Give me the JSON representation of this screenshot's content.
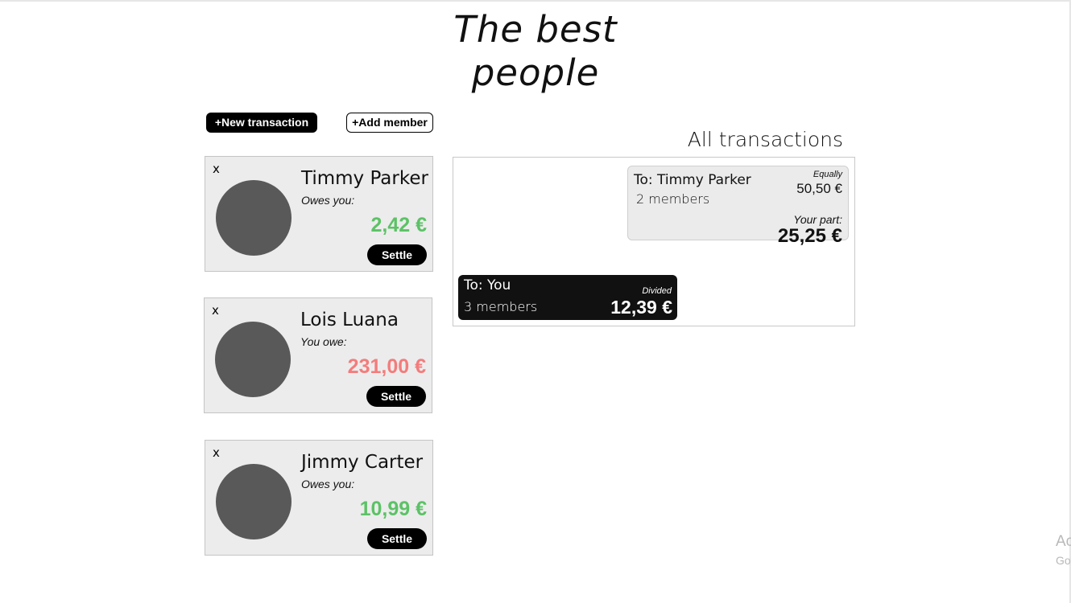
{
  "page": {
    "title": "The best people"
  },
  "actions": {
    "new_transaction_label": "+New transaction",
    "add_member_label": "+Add member"
  },
  "members": [
    {
      "close_label": "x",
      "name": "Timmy Parker",
      "status": "Owes you:",
      "amount": "2,42 €",
      "amount_color": "#5cc266",
      "settle_label": "Settle"
    },
    {
      "close_label": "x",
      "name": "Lois Luana",
      "status": "You owe:",
      "amount": "231,00 €",
      "amount_color": "#f47c7c",
      "settle_label": "Settle"
    },
    {
      "close_label": "x",
      "name": "Jimmy Carter",
      "status": "Owes you:",
      "amount": "10,99 €",
      "amount_color": "#5cc266",
      "settle_label": "Settle"
    }
  ],
  "transactions": {
    "heading": "All transactions",
    "items": [
      {
        "to": "To: Timmy Parker",
        "members": "2 members",
        "mode": "Equally",
        "total": "50,50 €",
        "part_label": "Your part:",
        "part_value": "25,25 €"
      },
      {
        "to": "To: You",
        "members": "3 members",
        "mode": "Divided",
        "total": "12,39 €"
      }
    ]
  },
  "watermark": {
    "line1": "Ac",
    "line2": "Go"
  }
}
